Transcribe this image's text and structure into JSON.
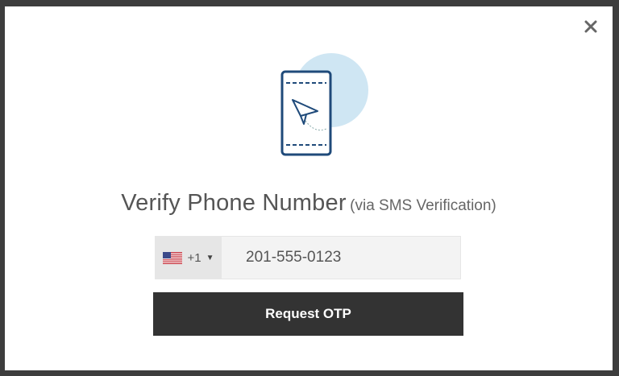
{
  "modal": {
    "title_main": "Verify Phone Number",
    "title_sub": "(via SMS Verification)",
    "close_icon": "close-icon"
  },
  "phone": {
    "country_flag": "us-flag-icon",
    "country_code": "+1",
    "value": "201-555-0123"
  },
  "actions": {
    "request_label": "Request OTP"
  },
  "colors": {
    "button_bg": "#333333",
    "illustration_stroke": "#1f4a7a",
    "illustration_circle": "#cfe6f3"
  }
}
